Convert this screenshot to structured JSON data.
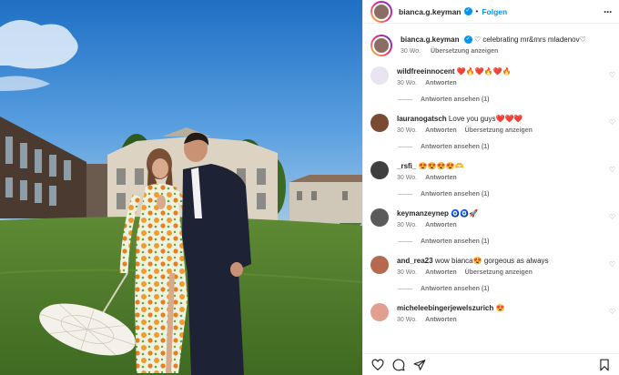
{
  "post": {
    "username": "bianca.g.keyman",
    "follow_label": "Folgen",
    "more_icon": "more-horizontal-icon",
    "caption": "♡ celebrating mr&mrs mladenov♡",
    "caption_time": "30 Wo.",
    "caption_translate": "Übersetzung anzeigen"
  },
  "comments": [
    {
      "user": "wildfreeinnocent",
      "text": "❤️🔥❤️🔥❤️🔥",
      "time": "30 Wo.",
      "reply": "Antworten",
      "translate": "",
      "view_replies": "Antworten ansehen (1)",
      "avatar_color": "#e9e4ef"
    },
    {
      "user": "lauranogatsch",
      "text": "Love you guys❤️❤️❤️",
      "time": "30 Wo.",
      "reply": "Antworten",
      "translate": "Übersetzung anzeigen",
      "view_replies": "Antworten ansehen (1)",
      "avatar_color": "#7a4a33"
    },
    {
      "user": "_rsfi_",
      "text": "😍😍😍😍🫶",
      "time": "30 Wo.",
      "reply": "Antworten",
      "translate": "",
      "view_replies": "Antworten ansehen (1)",
      "avatar_color": "#3f3f3f"
    },
    {
      "user": "keymanzeynep",
      "text": "🧿🧿🚀",
      "time": "30 Wo.",
      "reply": "Antworten",
      "translate": "",
      "view_replies": "Antworten ansehen (1)",
      "avatar_color": "#5b5b5b"
    },
    {
      "user": "and_rea23",
      "text": "wow bianca😍 gorgeous as always",
      "time": "30 Wo.",
      "reply": "Antworten",
      "translate": "Übersetzung anzeigen",
      "view_replies": "Antworten ansehen (1)",
      "avatar_color": "#b56a4f"
    },
    {
      "user": "micheleebingerjewelszurich",
      "text": "😍",
      "time": "30 Wo.",
      "reply": "Antworten",
      "translate": "",
      "view_replies": "",
      "avatar_color": "#e1a08f"
    }
  ],
  "actions": {
    "like": "heart-icon",
    "comment": "comment-icon",
    "share": "share-icon",
    "save": "bookmark-icon"
  },
  "colors": {
    "link_blue": "#0095f6",
    "meta_gray": "#737373",
    "sky": "#2f7fd0",
    "lawn": "#4f7a2a"
  }
}
